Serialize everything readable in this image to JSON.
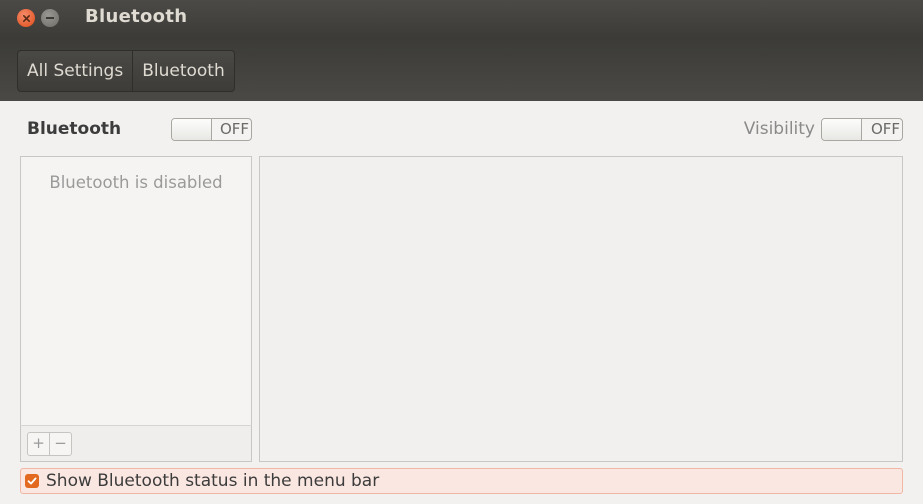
{
  "window": {
    "title": "Bluetooth"
  },
  "breadcrumb": {
    "all_settings": "All Settings",
    "current": "Bluetooth"
  },
  "bluetooth": {
    "label": "Bluetooth",
    "state": "OFF"
  },
  "visibility": {
    "label": "Visibility",
    "state": "OFF"
  },
  "device_list": {
    "empty_text": "Bluetooth is disabled",
    "add": "+",
    "remove": "−"
  },
  "menu_option": {
    "label": "Show Bluetooth status in the menu bar",
    "checked": true
  },
  "colors": {
    "accent": "#e2691f",
    "titlebar": "#3c3b37",
    "background": "#f2f1f0"
  },
  "icons": {
    "close": "close-icon",
    "minimize": "minimize-icon",
    "check": "check-icon"
  }
}
